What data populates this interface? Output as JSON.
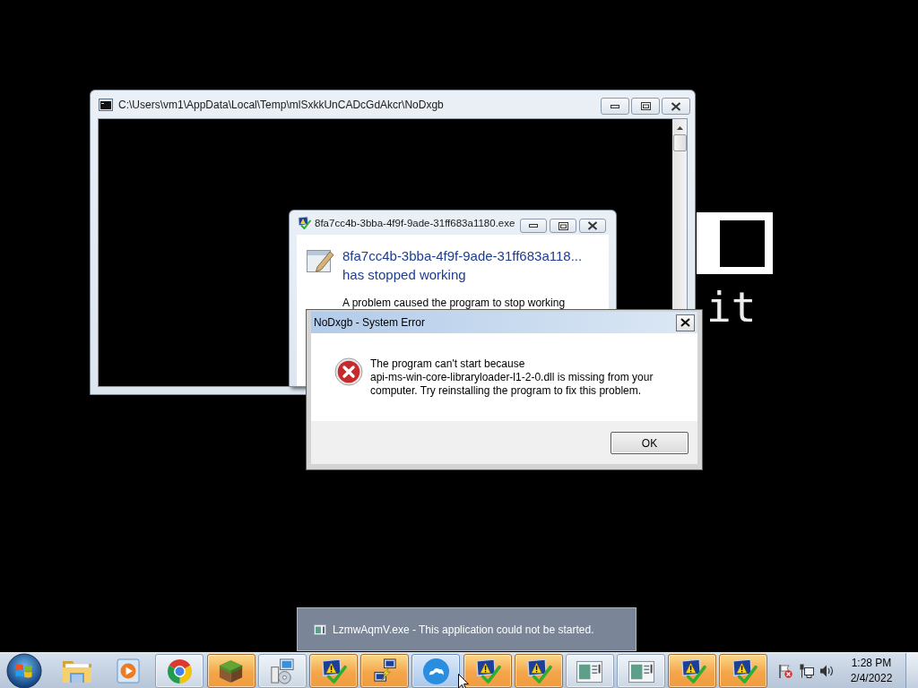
{
  "desktop": {
    "background_text": "it"
  },
  "console_window": {
    "title": "C:\\Users\\vm1\\AppData\\Local\\Temp\\mlSxkkUnCADcGdAkcr\\NoDxgb"
  },
  "crash_dialog": {
    "title": "8fa7cc4b-3bba-4f9f-9ade-31ff683a1180.exe",
    "heading": "8fa7cc4b-3bba-4f9f-9ade-31ff683a118...",
    "subheading": "has stopped working",
    "message": "A problem caused the program to stop working"
  },
  "error_dialog": {
    "title": "NoDxgb - System Error",
    "message": "The program can't start because\napi-ms-win-core-libraryloader-l1-2-0.dll is missing from your computer. Try reinstalling the program to fix this problem.",
    "buttons": [
      "OK"
    ]
  },
  "notification": {
    "text": "LzmwAqmV.exe - This application could not be started."
  },
  "taskbar": {
    "items": [
      {
        "kind": "folder",
        "running": false,
        "flashing": false,
        "hovered": false
      },
      {
        "kind": "media",
        "running": false,
        "flashing": false,
        "hovered": false
      },
      {
        "kind": "browser",
        "running": true,
        "flashing": false,
        "hovered": false
      },
      {
        "kind": "block",
        "running": true,
        "flashing": true,
        "hovered": false
      },
      {
        "kind": "installer",
        "running": true,
        "flashing": false,
        "hovered": false
      },
      {
        "kind": "warning",
        "running": true,
        "flashing": true,
        "hovered": false
      },
      {
        "kind": "network",
        "running": true,
        "flashing": true,
        "hovered": false
      },
      {
        "kind": "cloud",
        "running": true,
        "flashing": false,
        "hovered": true
      },
      {
        "kind": "warning",
        "running": true,
        "flashing": true,
        "hovered": false
      },
      {
        "kind": "warning",
        "running": true,
        "flashing": true,
        "hovered": false
      },
      {
        "kind": "window",
        "running": true,
        "flashing": false,
        "hovered": false
      },
      {
        "kind": "window",
        "running": true,
        "flashing": false,
        "hovered": false
      },
      {
        "kind": "warning",
        "running": true,
        "flashing": true,
        "hovered": false
      },
      {
        "kind": "warning",
        "running": true,
        "flashing": true,
        "hovered": false
      }
    ],
    "tray": {
      "time": "1:28 PM",
      "date": "2/4/2022"
    }
  }
}
